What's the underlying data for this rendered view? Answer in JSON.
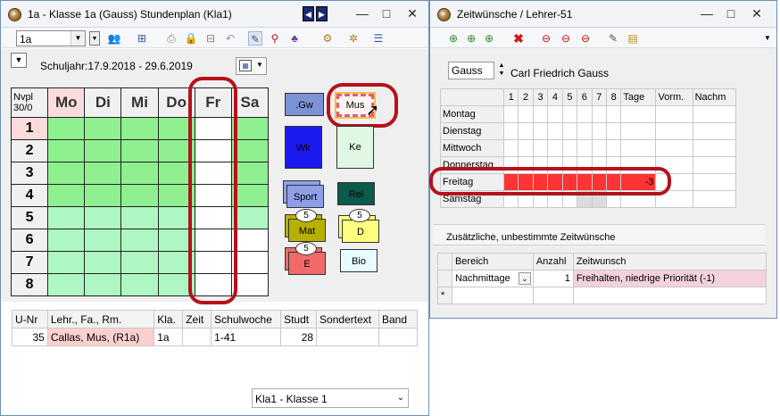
{
  "left_window": {
    "title": "1a - Klasse 1a (Gauss)  Stundenplan  (Kla1)",
    "controls": {
      "minimize": "—",
      "maximize": "□",
      "close": "✕",
      "prev": "◀",
      "next": "▶"
    },
    "class_select": "1a",
    "period_label": "Schuljahr:17.9.2018 - 29.6.2019",
    "grid_corner": {
      "line1": "Nvpl",
      "line2": "30/0"
    },
    "days": [
      "Mo",
      "Di",
      "Mi",
      "Do",
      "Fr",
      "Sa"
    ],
    "periods": [
      "1",
      "2",
      "3",
      "4",
      "5",
      "6",
      "7",
      "8"
    ],
    "lessons": {
      "gw": ".Gw",
      "mus": "Mus",
      "wk": "Wk",
      "ke": "Ke",
      "sport": "Sport",
      "rel": "Rel",
      "mat": "Mat",
      "d": "D",
      "e": "E",
      "bio": "Bio",
      "badge_mat": "5",
      "badge_d": "5",
      "badge_e": "5"
    },
    "lower_table": {
      "headers": [
        "U-Nr",
        "Lehr., Fa., Rm.",
        "Kla.",
        "Zeit",
        "Schulwoche",
        "Studt",
        "Sondertext",
        "Band"
      ],
      "row": [
        "35",
        "Callas, Mus, (R1a)",
        "1a",
        "",
        "1-41",
        "28",
        "",
        ""
      ]
    },
    "bottom_select": "Kla1 - Klasse 1",
    "colors": {
      "green": "#8ff08f",
      "light_green": "#aef7c2"
    }
  },
  "right_window": {
    "title": "Zeitwünsche / Lehrer-51",
    "controls": {
      "minimize": "—",
      "maximize": "□",
      "close": "✕"
    },
    "teacher_short": "Gauss",
    "teacher_name": "Carl Friedrich Gauss",
    "col_headers": [
      "1",
      "2",
      "3",
      "4",
      "5",
      "6",
      "7",
      "8",
      "Tage",
      "Vorm.",
      "Nachm"
    ],
    "days": [
      "Montag",
      "Dienstag",
      "Mittwoch",
      "Donnerstag",
      "Freitag",
      "Samstag"
    ],
    "friday_value": "-3",
    "section_label": "Zusätzliche, unbestimmte Zeitwünsche",
    "extra_headers": [
      "Bereich",
      "Anzahl",
      "Zeitwunsch"
    ],
    "extra_row": {
      "bereich": "Nachmittage",
      "anzahl": "1",
      "zeitwunsch": "Freihalten, niedrige Priorität (-1)"
    },
    "new_row_marker": "*",
    "colors": {
      "red": "#ff3333"
    }
  }
}
